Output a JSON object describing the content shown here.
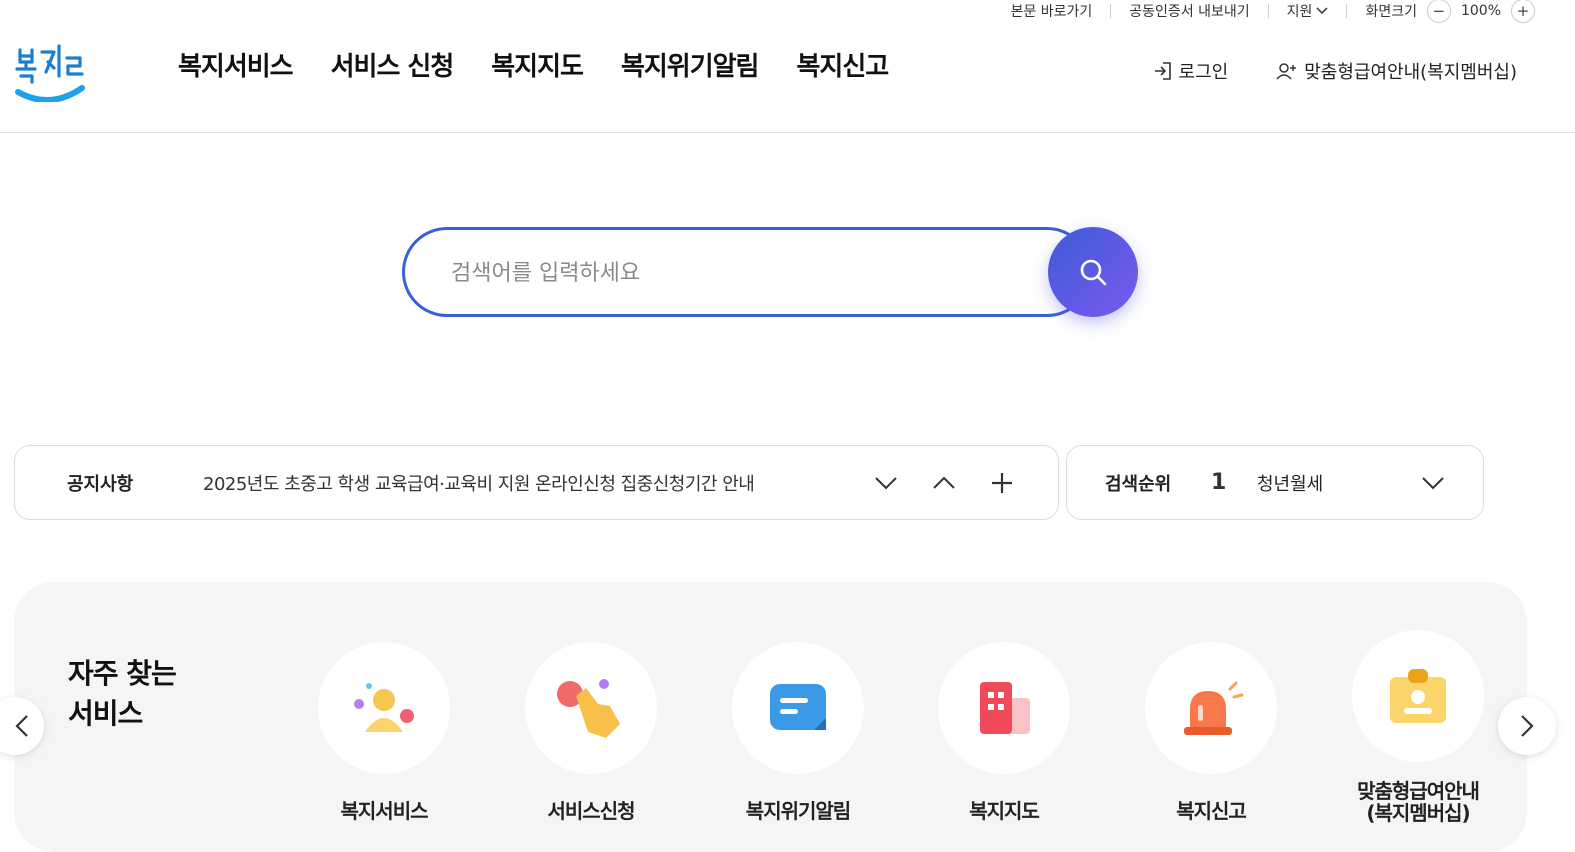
{
  "util": {
    "skip": "본문 바로가기",
    "cert": "공동인증서 내보내기",
    "lang": "지원",
    "zoom_label": "화면크기",
    "zoom_value": "100%",
    "minus": "−",
    "plus": "+"
  },
  "logo": {
    "text": "복지로"
  },
  "nav": [
    "복지서비스",
    "서비스 신청",
    "복지지도",
    "복지위기알림",
    "복지신고"
  ],
  "header_right": {
    "login": "로그인",
    "membership": "맞춤형급여안내(복지멤버십)"
  },
  "search": {
    "placeholder": "검색어를 입력하세요"
  },
  "notice": {
    "title": "공지사항",
    "text": "2025년도 초중고 학생 교육급여·교육비 지원 온라인신청 집중신청기간 안내"
  },
  "rank": {
    "title": "검색순위",
    "number": "1",
    "keyword": "청년월세"
  },
  "services": {
    "title_line1": "자주 찾는",
    "title_line2": "서비스",
    "items": [
      {
        "label": "복지서비스",
        "icon": "people-icon"
      },
      {
        "label": "서비스신청",
        "icon": "tap-hand-icon"
      },
      {
        "label": "복지위기알림",
        "icon": "message-icon"
      },
      {
        "label": "복지지도",
        "icon": "building-icon"
      },
      {
        "label": "복지신고",
        "icon": "siren-icon"
      },
      {
        "label": "맞춤형급여안내\n(복지멤버십)",
        "label1": "맞춤형급여안내",
        "label2": "(복지멤버십)",
        "icon": "id-card-icon"
      }
    ]
  },
  "colors": {
    "accent": "#3b5fd6",
    "accent2": "#7a5af0",
    "logo_blue": "#1aa3e8"
  }
}
